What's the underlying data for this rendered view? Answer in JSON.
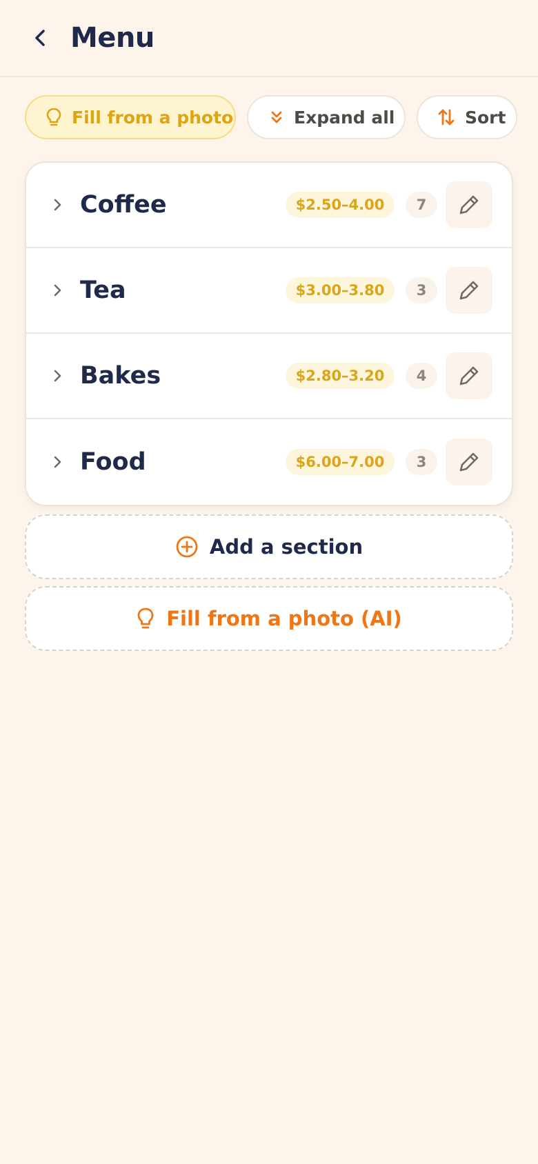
{
  "header": {
    "title": "Menu",
    "back_icon": "chevron-left-icon"
  },
  "toolbar": {
    "fill_label": "Fill from a photo",
    "expand_label": "Expand all",
    "sort_label": "Sort"
  },
  "sections": [
    {
      "name": "Coffee",
      "price_range": "$2.50–4.00",
      "count": "7"
    },
    {
      "name": "Tea",
      "price_range": "$3.00–3.80",
      "count": "3"
    },
    {
      "name": "Bakes",
      "price_range": "$2.80–3.20",
      "count": "4"
    },
    {
      "name": "Food",
      "price_range": "$6.00–7.00",
      "count": "3"
    }
  ],
  "actions": {
    "add_section_label": "Add a section",
    "fill_ai_label": "Fill from a photo (AI)"
  },
  "colors": {
    "background": "#fdf5ec",
    "navy": "#1f2a4a",
    "accent_orange": "#ee7616",
    "accent_yellow": "#dba516"
  }
}
